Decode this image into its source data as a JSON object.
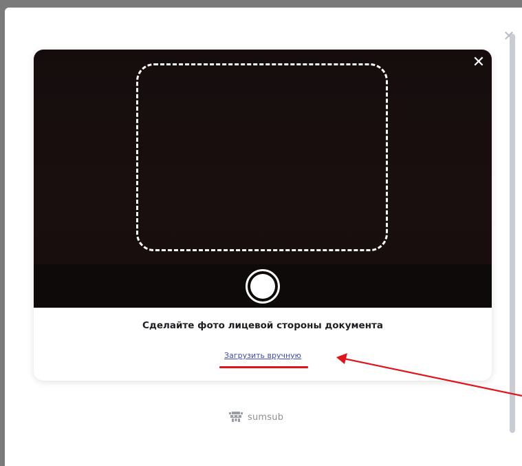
{
  "modal": {
    "close_icon": "close-icon"
  },
  "camera": {
    "close_icon": "close-icon",
    "shutter_icon": "camera-shutter-icon"
  },
  "instructions": {
    "title": "Сделайте фото лицевой стороны документа",
    "upload_link": "Загрузить вручную"
  },
  "brand": {
    "name": "sumsub",
    "logo_icon": "sumsub-logo-icon"
  },
  "annotation": {
    "color": "#e0141a"
  }
}
